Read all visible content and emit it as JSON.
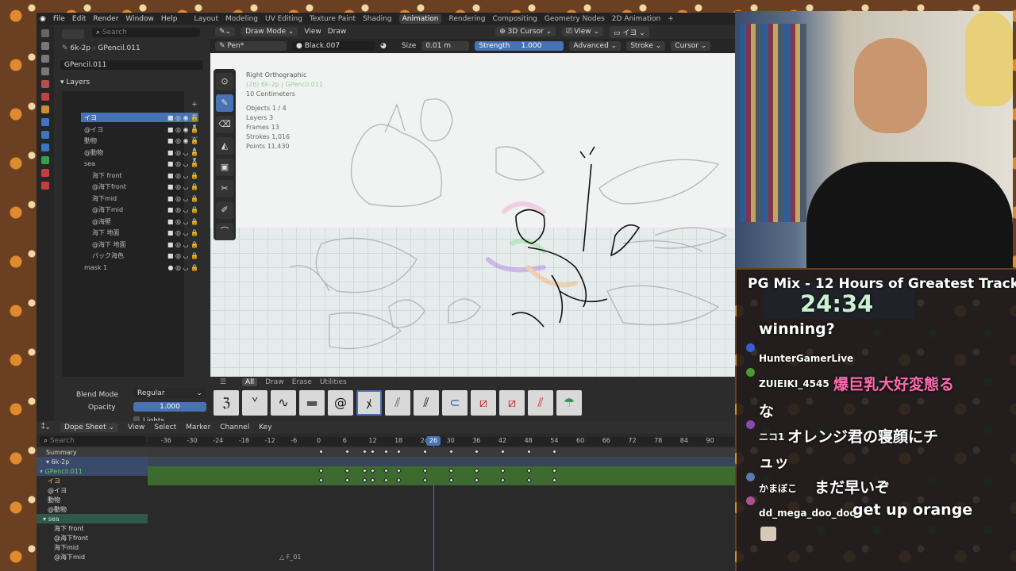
{
  "topbar": {
    "menus": [
      "File",
      "Edit",
      "Render",
      "Window",
      "Help"
    ],
    "workspaces": [
      "Layout",
      "Modeling",
      "UV Editing",
      "Texture Paint",
      "Shading",
      "Animation",
      "Rendering",
      "Compositing",
      "Geometry Nodes",
      "2D Animation"
    ],
    "active_workspace": "Animation",
    "plus": "+"
  },
  "props": {
    "scene": "6k-2p",
    "object": "GPencil.011",
    "data": "GPencil.011",
    "search": "Search",
    "layers_title": "Layers",
    "layers": [
      "イヨ",
      "@イヨ",
      "動物",
      "@動物",
      "sea",
      "海下 front",
      "@海下front",
      "海下mid",
      "@海下mid",
      "@海壁",
      "海下 地面",
      "@海下 地面",
      "パック海色",
      "mask 1"
    ],
    "blend_mode_label": "Blend Mode",
    "blend_mode": "Regular",
    "opacity_label": "Opacity",
    "opacity": "1.000",
    "lights": "Lights"
  },
  "viewport": {
    "mode": "Draw Mode",
    "view": "View",
    "draw": "Draw",
    "cursor_label": "3D Cursor",
    "view2": "View",
    "layer_sel": "イヨ",
    "brush": "Pen*",
    "material": "Black.007",
    "size_label": "Size",
    "size": "0.01 m",
    "strength_label": "Strength",
    "strength": "1.000",
    "advanced": "Advanced",
    "stroke": "Stroke",
    "cursor": "Cursor",
    "overlay": [
      "Right Orthographic",
      "(26) 6k-2p | GPencil.011",
      "10 Centimeters",
      "Objects   1 / 4",
      "Layers   3",
      "Frames   13",
      "Strokes   1,016",
      "Points   11,430"
    ]
  },
  "brushbar": {
    "tabs": [
      "All",
      "Draw",
      "Erase",
      "Utilities"
    ],
    "active": "All",
    "brushes": [
      "pen-brush",
      "ink-brush",
      "pencil-brush",
      "marker-brush",
      "airbrush",
      "line-brush",
      "noise-brush",
      "chisel-brush",
      "blend-brush",
      "erase-brush",
      "erase-point-brush",
      "fill-red-brush",
      "fill-green-brush"
    ]
  },
  "dope": {
    "editor": "Dope Sheet",
    "menus": [
      "View",
      "Select",
      "Marker",
      "Channel",
      "Key"
    ],
    "search": "Search",
    "ticks": [
      "-36",
      "-30",
      "-24",
      "-18",
      "-12",
      "-6",
      "0",
      "6",
      "12",
      "18",
      "24",
      "30",
      "36",
      "42",
      "48",
      "54",
      "60",
      "66",
      "72",
      "78",
      "84",
      "90"
    ],
    "current_frame": "26",
    "marker": "F_01",
    "channels": [
      "Summary",
      "6k-2p",
      "GPencil.011",
      "イヨ",
      "@イヨ",
      "動物",
      "@動物",
      "sea",
      "海下  front",
      "@海下front",
      "海下mid",
      "@海下mid"
    ],
    "keyframes": [
      0,
      6,
      10,
      12,
      15,
      18,
      24,
      30,
      36,
      42,
      48,
      54
    ]
  },
  "stream": {
    "title": "PG Mix - 12 Hours of Greatest Track",
    "timer": "24:34",
    "chat": [
      {
        "user": "",
        "msg": "winning?"
      },
      {
        "user": "HunterGamerLive",
        "msg": ""
      },
      {
        "user": "ZUIEIKI_4545",
        "msg": "爆巨乳大好変態る"
      },
      {
        "user": "",
        "msg": "な"
      },
      {
        "user": "ニコ1",
        "msg": "オレンジ君の寝顔にチ"
      },
      {
        "user": "",
        "msg": "ュッ"
      },
      {
        "user": "かまぼこ",
        "msg": "まだ早いぞ"
      },
      {
        "user": "dd_mega_doo_doo",
        "msg": "get up orange"
      }
    ]
  },
  "colors": {
    "accent": "#4772b3",
    "keyframe_row": "#3d6a2e",
    "playhead": "#4772b3",
    "sea_row": "#2e5a4a"
  }
}
